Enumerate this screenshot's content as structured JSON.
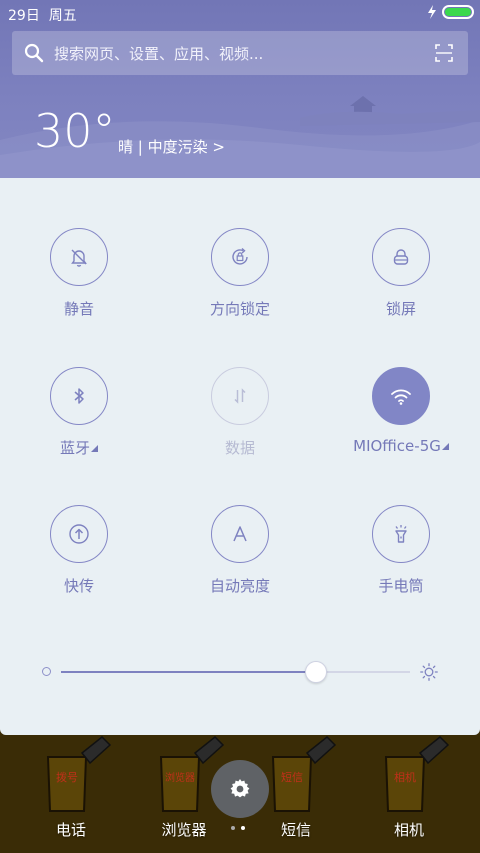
{
  "status": {
    "date": "29日",
    "weekday": "周五",
    "battery_level": 1.0
  },
  "search": {
    "placeholder": "搜索网页、设置、应用、视频..."
  },
  "weather": {
    "temperature": "30°",
    "detail": "晴 | 中度污染 >"
  },
  "quick_tiles": [
    {
      "label": "静音",
      "icon": "bell-off-icon",
      "state": "off"
    },
    {
      "label": "方向锁定",
      "icon": "rotation-lock-icon",
      "state": "off"
    },
    {
      "label": "锁屏",
      "icon": "lock-icon",
      "state": "off"
    },
    {
      "label": "蓝牙",
      "icon": "bluetooth-icon",
      "state": "off",
      "has_menu": true
    },
    {
      "label": "数据",
      "icon": "data-arrows-icon",
      "state": "disabled"
    },
    {
      "label": "MIOffice-5G",
      "icon": "wifi-icon",
      "state": "on",
      "has_menu": true
    },
    {
      "label": "快传",
      "icon": "transfer-icon",
      "state": "off"
    },
    {
      "label": "自动亮度",
      "icon": "auto-brightness-icon",
      "state": "off"
    },
    {
      "label": "手电筒",
      "icon": "flashlight-icon",
      "state": "off"
    }
  ],
  "brightness": {
    "level": 0.73
  },
  "dock": {
    "apps": [
      {
        "label": "电话",
        "icon_text": "拨号"
      },
      {
        "label": "浏览器",
        "icon_text": "浏览器"
      },
      {
        "label": "短信",
        "icon_text": "短信"
      },
      {
        "label": "相机",
        "icon_text": "相机"
      }
    ],
    "page_count": 2,
    "current_page": 2
  },
  "colors": {
    "accent": "#8186c6",
    "header": "#7b7fbd",
    "panel": "#e9f0f4"
  }
}
